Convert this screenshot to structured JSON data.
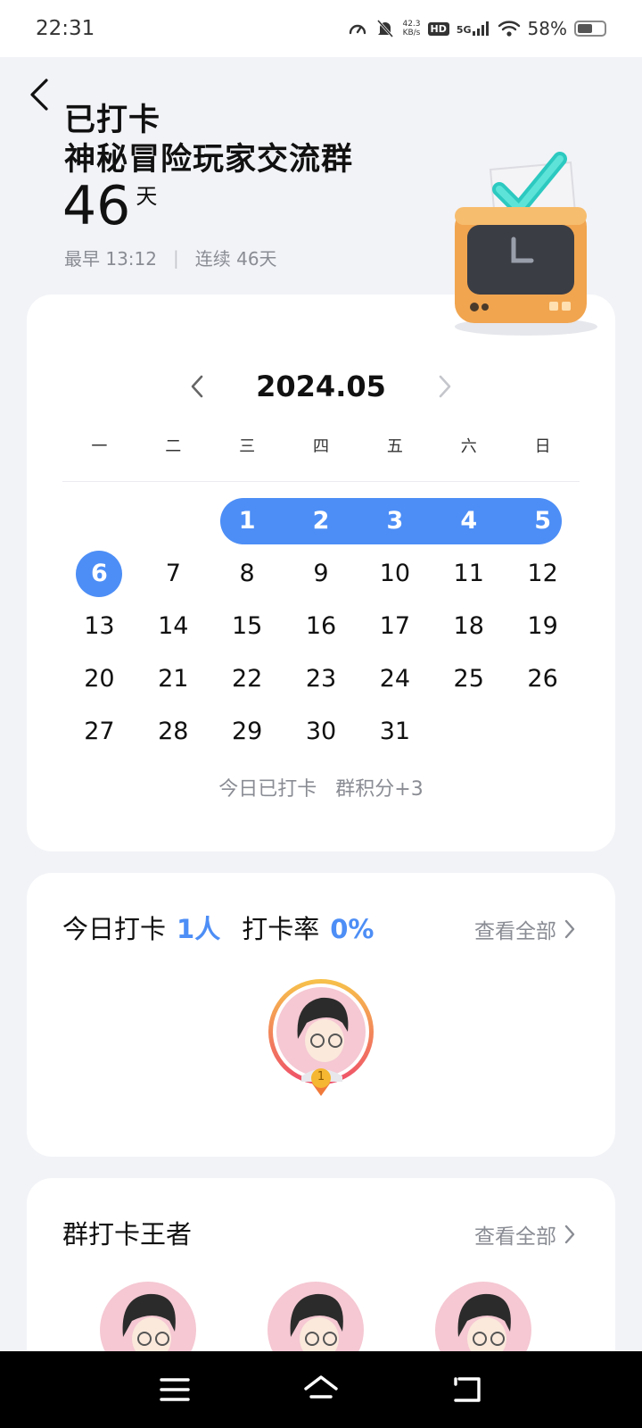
{
  "status_bar": {
    "time": "22:31",
    "net_speed_value": "42.3",
    "net_speed_unit": "KB/s",
    "hd": "HD",
    "network": "5G",
    "battery": "58%"
  },
  "header": {
    "status_label": "已打卡",
    "group_name": "神秘冒险玩家交流群",
    "days_count": "46",
    "days_unit": "天",
    "earliest": "最早 13:12",
    "separator": "|",
    "streak": "连续 46天"
  },
  "calendar": {
    "month": "2024.05",
    "weekdays": [
      "一",
      "二",
      "三",
      "四",
      "五",
      "六",
      "日"
    ],
    "rows": [
      [
        "",
        "",
        "1",
        "2",
        "3",
        "4",
        "5"
      ],
      [
        "6",
        "7",
        "8",
        "9",
        "10",
        "11",
        "12"
      ],
      [
        "13",
        "14",
        "15",
        "16",
        "17",
        "18",
        "19"
      ],
      [
        "20",
        "21",
        "22",
        "23",
        "24",
        "25",
        "26"
      ],
      [
        "27",
        "28",
        "29",
        "30",
        "31",
        "",
        ""
      ]
    ],
    "checked_days": [
      "1",
      "2",
      "3",
      "4",
      "5",
      "6"
    ],
    "note": "今日已打卡   群积分+3"
  },
  "today": {
    "label": "今日打卡",
    "count": "1人",
    "rate_label": "打卡率",
    "rate": "0%",
    "view_all": "查看全部",
    "medal": "1"
  },
  "king": {
    "title": "群打卡王者",
    "view_all": "查看全部"
  },
  "colors": {
    "accent": "#4d8ef6",
    "background": "#f2f3f7",
    "card": "#ffffff",
    "muted": "#8a8c94"
  }
}
